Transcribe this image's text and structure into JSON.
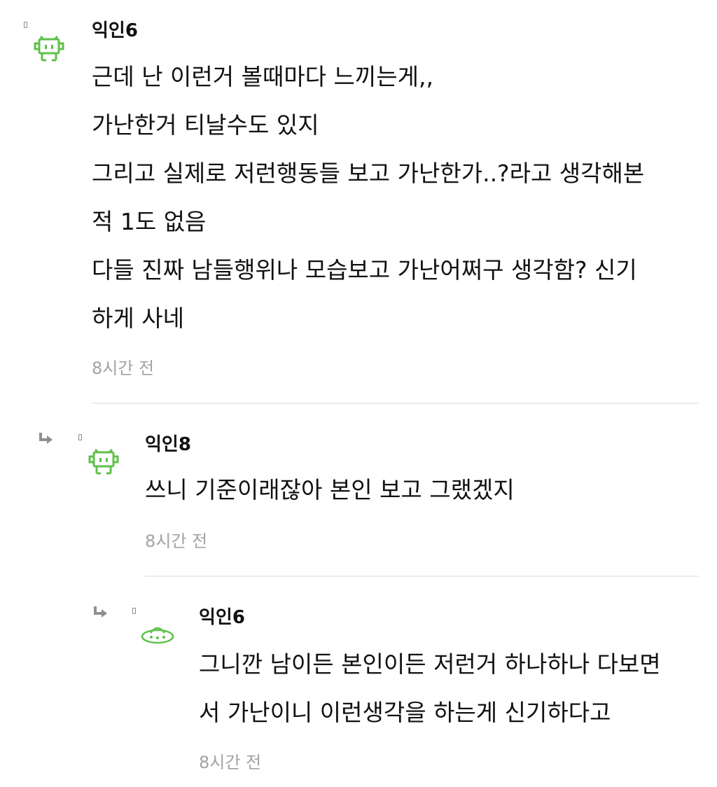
{
  "comments": [
    {
      "author": "익인6",
      "avatar": "green-invader-icon",
      "lines": [
        "근데 난 이런거 볼때마다 느끼는게,,",
        "가난한거 티날수도 있지",
        "그리고 실제로 저런행동들 보고 가난한가..?라고 생각해본",
        "적 1도 없음",
        "다들 진짜 남들행위나 모습보고 가난어쩌구 생각함? 신기",
        "하게 사네"
      ],
      "time": "8시간 전"
    },
    {
      "author": "익인8",
      "avatar": "green-invader-icon",
      "lines": [
        "쓰니 기준이래잖아 본인 보고 그랬겠지"
      ],
      "time": "8시간 전"
    },
    {
      "author": "익인6",
      "avatar": "green-ufo-icon",
      "lines": [
        "그니깐 남이든 본인이든 저런거 하나하나 다보면",
        "서 가난이니 이런생각을 하는게 신기하다고"
      ],
      "time": "8시간 전"
    }
  ],
  "colors": {
    "text": "#111111",
    "muted": "#a3a3a3",
    "divider": "#ececec",
    "avatar_green": "#5fc04a",
    "reply_arrow": "#8f8f8f"
  }
}
